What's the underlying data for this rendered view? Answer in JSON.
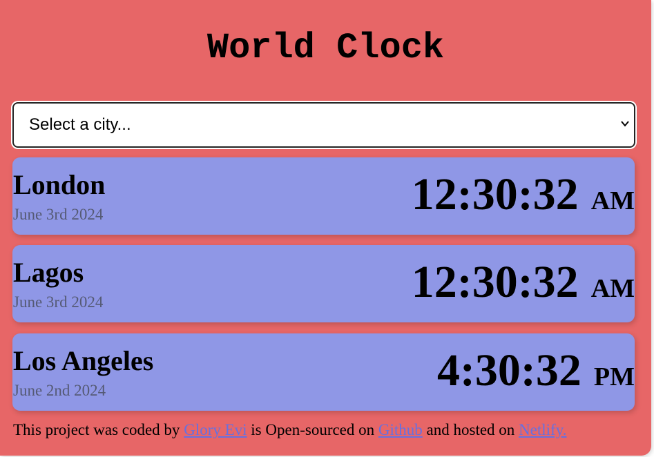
{
  "header": {
    "title": "World Clock"
  },
  "city_select": {
    "selected": "Select a city...",
    "chevron_icon": "chevron-down-icon"
  },
  "cities": [
    {
      "name": "London",
      "date": "June 3rd 2024",
      "time": "12:30:32",
      "ampm": "AM"
    },
    {
      "name": "Lagos",
      "date": "June 3rd 2024",
      "time": "12:30:32",
      "ampm": "AM"
    },
    {
      "name": "Los Angeles",
      "date": "June 2nd 2024",
      "time": "4:30:32",
      "ampm": "PM"
    }
  ],
  "footer": {
    "text_1": "This project was coded by ",
    "author_link": "Glory Evi",
    "text_2": " is Open-sourced on ",
    "github_link": "Github",
    "text_3": " and hosted on ",
    "netlify_link": "Netlify."
  },
  "colors": {
    "background": "#e76667",
    "city_card": "#8f97e6",
    "date_text": "#555a74",
    "link": "#6670e0"
  }
}
